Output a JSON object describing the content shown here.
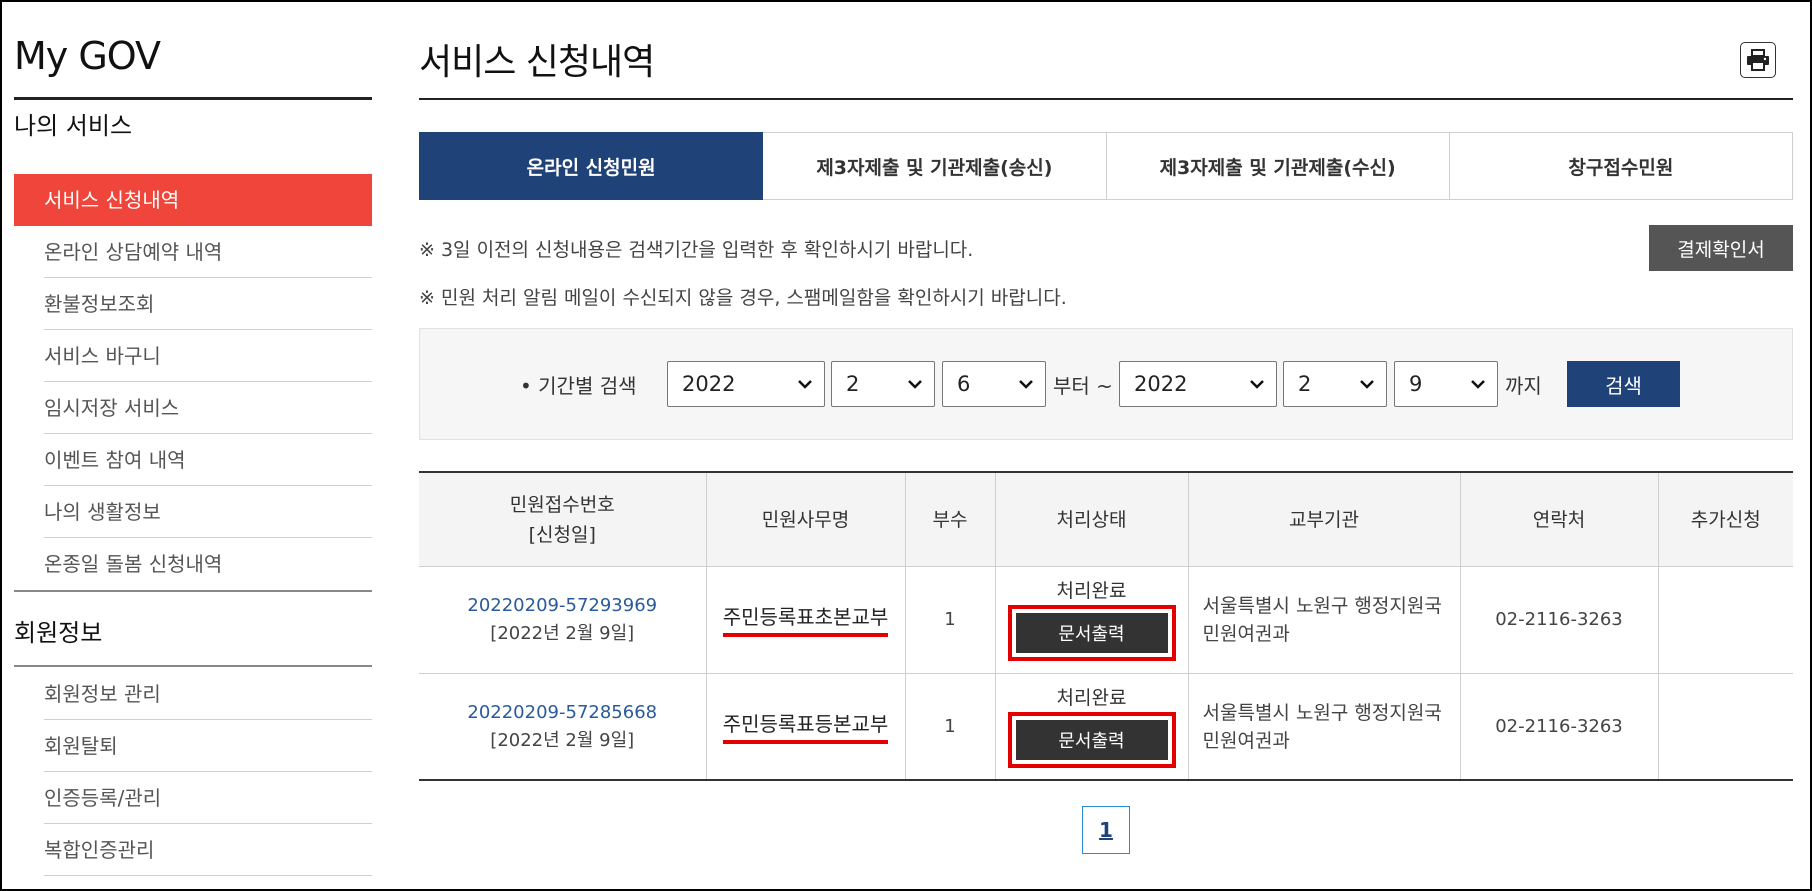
{
  "sidebar": {
    "title": "My GOV",
    "section_services": "나의 서비스",
    "services": [
      "서비스 신청내역",
      "온라인 상담예약 내역",
      "환불정보조회",
      "서비스 바구니",
      "임시저장 서비스",
      "이벤트 참여 내역",
      "나의 생활정보",
      "온종일 돌봄 신청내역"
    ],
    "section_member": "회원정보",
    "member": [
      "회원정보 관리",
      "회원탈퇴",
      "인증등록/관리",
      "복합인증관리"
    ]
  },
  "header": {
    "title": "서비스 신청내역",
    "print_icon": "printer-icon"
  },
  "tabs": [
    "온라인 신청민원",
    "제3자제출 및 기관제출(송신)",
    "제3자제출 및 기관제출(수신)",
    "창구접수민원"
  ],
  "notices": [
    "※ 3일 이전의 신청내용은 검색기간을 입력한 후 확인하시기 바랍니다.",
    "※ 민원 처리 알림 메일이 수신되지 않을 경우, 스팸메일함을 확인하시기 바랍니다."
  ],
  "payment_button": "결제확인서",
  "search": {
    "label": "• 기간별 검색",
    "from_year": "2022",
    "from_month": "2",
    "from_day": "6",
    "from_text": "부터 ~",
    "to_year": "2022",
    "to_month": "2",
    "to_day": "9",
    "to_text": "까지",
    "button": "검색"
  },
  "table": {
    "headers": [
      "민원접수번호",
      "[신청일]",
      "민원사무명",
      "부수",
      "처리상태",
      "교부기관",
      "연락처",
      "추가신청"
    ],
    "rows": [
      {
        "receipt_no": "20220209-57293969",
        "date": "[2022년 2월 9일]",
        "name": "주민등록표초본교부",
        "copies": "1",
        "status": "처리완료",
        "print_button": "문서출력",
        "org_line1": "서울특별시 노원구 행정지원국",
        "org_line2": "민원여권과",
        "phone": "02-2116-3263"
      },
      {
        "receipt_no": "20220209-57285668",
        "date": "[2022년 2월 9일]",
        "name": "주민등록표등본교부",
        "copies": "1",
        "status": "처리완료",
        "print_button": "문서출력",
        "org_line1": "서울특별시 노원구 행정지원국",
        "org_line2": "민원여권과",
        "phone": "02-2116-3263"
      }
    ]
  },
  "pagination": {
    "current": "1"
  },
  "colors": {
    "brand_navy": "#1f4278",
    "active_red": "#f0453a",
    "highlight_red": "#e40000"
  }
}
